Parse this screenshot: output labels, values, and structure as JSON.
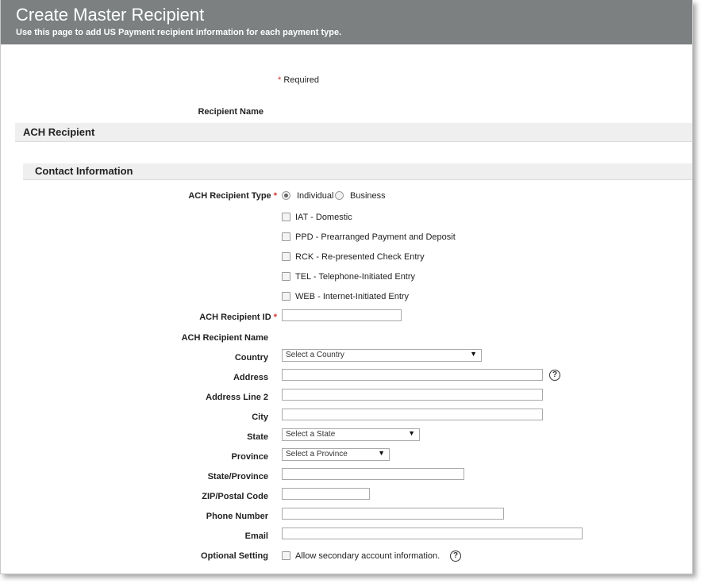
{
  "header": {
    "title": "Create Master Recipient",
    "subtitle": "Use this page to add US Payment recipient information for each payment type."
  },
  "required_note": {
    "asterisk": "*",
    "text": "Required"
  },
  "recipient_name_label": "Recipient Name",
  "ach_section_title": "ACH Recipient",
  "contact_section_title": "Contact Information",
  "ach_type": {
    "label": "ACH Recipient Type",
    "asterisk": "*",
    "options": [
      {
        "label": "Individual",
        "selected": true
      },
      {
        "label": "Business",
        "selected": false
      }
    ],
    "entry_classes": [
      {
        "label": "IAT - Domestic",
        "checked": false
      },
      {
        "label": "PPD - Prearranged Payment and Deposit",
        "checked": false
      },
      {
        "label": "RCK - Re-presented Check Entry",
        "checked": false
      },
      {
        "label": "TEL - Telephone-Initiated Entry",
        "checked": false
      },
      {
        "label": "WEB - Internet-Initiated Entry",
        "checked": false
      }
    ]
  },
  "fields": {
    "recipient_id": {
      "label": "ACH Recipient ID",
      "asterisk": "*",
      "value": ""
    },
    "recipient_name": {
      "label": "ACH Recipient Name"
    },
    "country": {
      "label": "Country",
      "selected": "Select a Country"
    },
    "address": {
      "label": "Address",
      "value": ""
    },
    "address2": {
      "label": "Address Line 2",
      "value": ""
    },
    "city": {
      "label": "City",
      "value": ""
    },
    "state": {
      "label": "State",
      "selected": "Select a State"
    },
    "province": {
      "label": "Province",
      "selected": "Select a Province"
    },
    "state_province": {
      "label": "State/Province",
      "value": ""
    },
    "zip": {
      "label": "ZIP/Postal Code",
      "value": ""
    },
    "phone": {
      "label": "Phone Number",
      "value": ""
    },
    "email": {
      "label": "Email",
      "value": ""
    }
  },
  "optional_setting": {
    "label": "Optional Setting",
    "checkbox_label": "Allow secondary account information.",
    "checked": false
  },
  "help_glyph": "?",
  "colors": {
    "header_bg": "#7c8080",
    "required": "#d0342c",
    "band_bg": "#eeefee"
  }
}
